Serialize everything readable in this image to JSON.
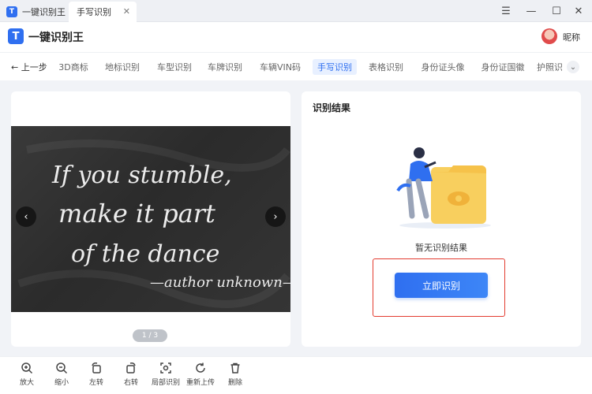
{
  "titlebar": {
    "home_tab": "一键识别王",
    "active_tab": "手写识别",
    "close_glyph": "✕",
    "controls": [
      "☰",
      "—",
      "☐",
      "✕"
    ]
  },
  "header": {
    "logo_letter": "T",
    "app_title": "一键识别王",
    "nickname": "昵称"
  },
  "nav": {
    "back_label": "上一步",
    "items": [
      {
        "label": "3D商标"
      },
      {
        "label": "地标识别"
      },
      {
        "label": "车型识别"
      },
      {
        "label": "车牌识别"
      },
      {
        "label": "车辆VIN码"
      },
      {
        "label": "手写识别"
      },
      {
        "label": "表格识别"
      },
      {
        "label": "身份证头像"
      },
      {
        "label": "身份证国徽"
      },
      {
        "label": "护照识"
      }
    ],
    "active_index": 5,
    "more_glyph": "⌄"
  },
  "image_panel": {
    "chalk_lines": [
      "If you stumble,",
      "make it part",
      "of the dance",
      "—author unknown—"
    ],
    "pager": "1 / 3",
    "prev_glyph": "‹",
    "next_glyph": "›"
  },
  "result_panel": {
    "title": "识别结果",
    "empty_text": "暂无识别结果",
    "recognize_button": "立即识别"
  },
  "toolbar": {
    "tools": [
      {
        "label": "放大",
        "icon": "zoom-in-icon"
      },
      {
        "label": "缩小",
        "icon": "zoom-out-icon"
      },
      {
        "label": "左转",
        "icon": "rotate-left-icon"
      },
      {
        "label": "右转",
        "icon": "rotate-right-icon"
      },
      {
        "label": "局部识别",
        "icon": "partial-scan-icon"
      },
      {
        "label": "重新上传",
        "icon": "reupload-icon"
      },
      {
        "label": "删除",
        "icon": "trash-icon"
      }
    ]
  },
  "colors": {
    "accent": "#2f6ff0",
    "highlight": "#e33b2f",
    "folder": "#f6c24a"
  }
}
